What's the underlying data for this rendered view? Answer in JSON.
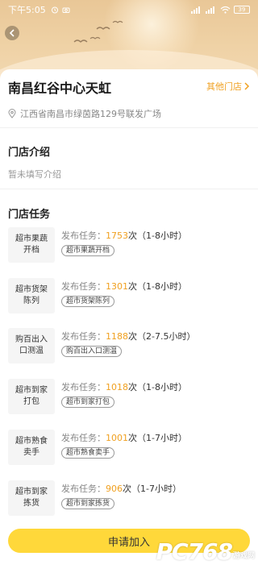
{
  "status_bar": {
    "time": "下午5:05",
    "battery": "39"
  },
  "store": {
    "name": "南昌红谷中心天虹",
    "other_stores_label": "其他门店",
    "address": "江西省南昌市绿茵路129号联发广场"
  },
  "intro": {
    "title": "门店介绍",
    "text": "暂未填写介绍"
  },
  "tasks": {
    "title": "门店任务",
    "items": [
      {
        "name": "超市果蔬开档",
        "prefix": "发布任务：",
        "count": "1753",
        "suffix": "次（1-8小时）",
        "tag": "超市果蔬开档"
      },
      {
        "name": "超市货架陈列",
        "prefix": "发布任务：",
        "count": "1301",
        "suffix": "次（1-8小时）",
        "tag": "超市货架陈列"
      },
      {
        "name": "购百出入口测温",
        "prefix": "发布任务：",
        "count": "1188",
        "suffix": "次（2-7.5小时）",
        "tag": "购百出入口测温"
      },
      {
        "name": "超市到家打包",
        "prefix": "发布任务：",
        "count": "1018",
        "suffix": "次（1-8小时）",
        "tag": "超市到家打包"
      },
      {
        "name": "超市熟食卖手",
        "prefix": "发布任务：",
        "count": "1001",
        "suffix": "次（1-7小时）",
        "tag": "超市熟食卖手"
      },
      {
        "name": "超市到家拣货",
        "prefix": "发布任务：",
        "count": "906",
        "suffix": "次（1-7小时）",
        "tag": "超市到家拣货"
      }
    ]
  },
  "apply_button": "申请加入",
  "watermark": {
    "big": "PC768",
    "small": "游戏网"
  },
  "colors": {
    "accent": "#f0a020",
    "button": "#ffd83a",
    "hero": "#efd2a6"
  },
  "icons": {
    "back": "chevron-left-icon",
    "location": "location-pin-icon",
    "arrow": "chevron-right-icon"
  }
}
